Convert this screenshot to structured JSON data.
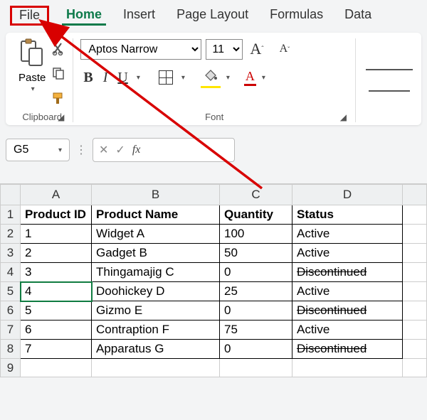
{
  "tabs": {
    "file": "File",
    "home": "Home",
    "insert": "Insert",
    "page_layout": "Page Layout",
    "formulas": "Formulas",
    "data": "Data"
  },
  "ribbon": {
    "paste_label": "Paste",
    "clipboard_label": "Clipboard",
    "font_label": "Font",
    "font_name": "Aptos Narrow",
    "font_size": "11",
    "bold": "B",
    "italic": "I",
    "underline": "U",
    "font_color_letter": "A",
    "grow_font": "A",
    "shrink_font": "A"
  },
  "namebox": {
    "cell_ref": "G5",
    "fx": "fx"
  },
  "columns": [
    "A",
    "B",
    "C",
    "D"
  ],
  "header_row": [
    "Product ID",
    "Product Name",
    "Quantity",
    "Status"
  ],
  "rows": [
    {
      "n": "1",
      "cells": [
        "Product ID",
        "Product Name",
        "Quantity",
        "Status"
      ],
      "hdr": true
    },
    {
      "n": "2",
      "cells": [
        "1",
        "Widget A",
        "100",
        "Active"
      ]
    },
    {
      "n": "3",
      "cells": [
        "2",
        "Gadget B",
        "50",
        "Active"
      ]
    },
    {
      "n": "4",
      "cells": [
        "3",
        "Thingamajig C",
        "0",
        "Discontinued"
      ],
      "strike": true
    },
    {
      "n": "5",
      "cells": [
        "4",
        "Doohickey D",
        "25",
        "Active"
      ],
      "sel": true
    },
    {
      "n": "6",
      "cells": [
        "5",
        "Gizmo E",
        "0",
        "Discontinued"
      ],
      "strike": true
    },
    {
      "n": "7",
      "cells": [
        "6",
        "Contraption F",
        "75",
        "Active"
      ]
    },
    {
      "n": "8",
      "cells": [
        "7",
        "Apparatus G",
        "0",
        "Discontinued"
      ],
      "strike": true
    },
    {
      "n": "9",
      "cells": [
        "",
        "",
        "",
        ""
      ],
      "empty": true
    }
  ]
}
